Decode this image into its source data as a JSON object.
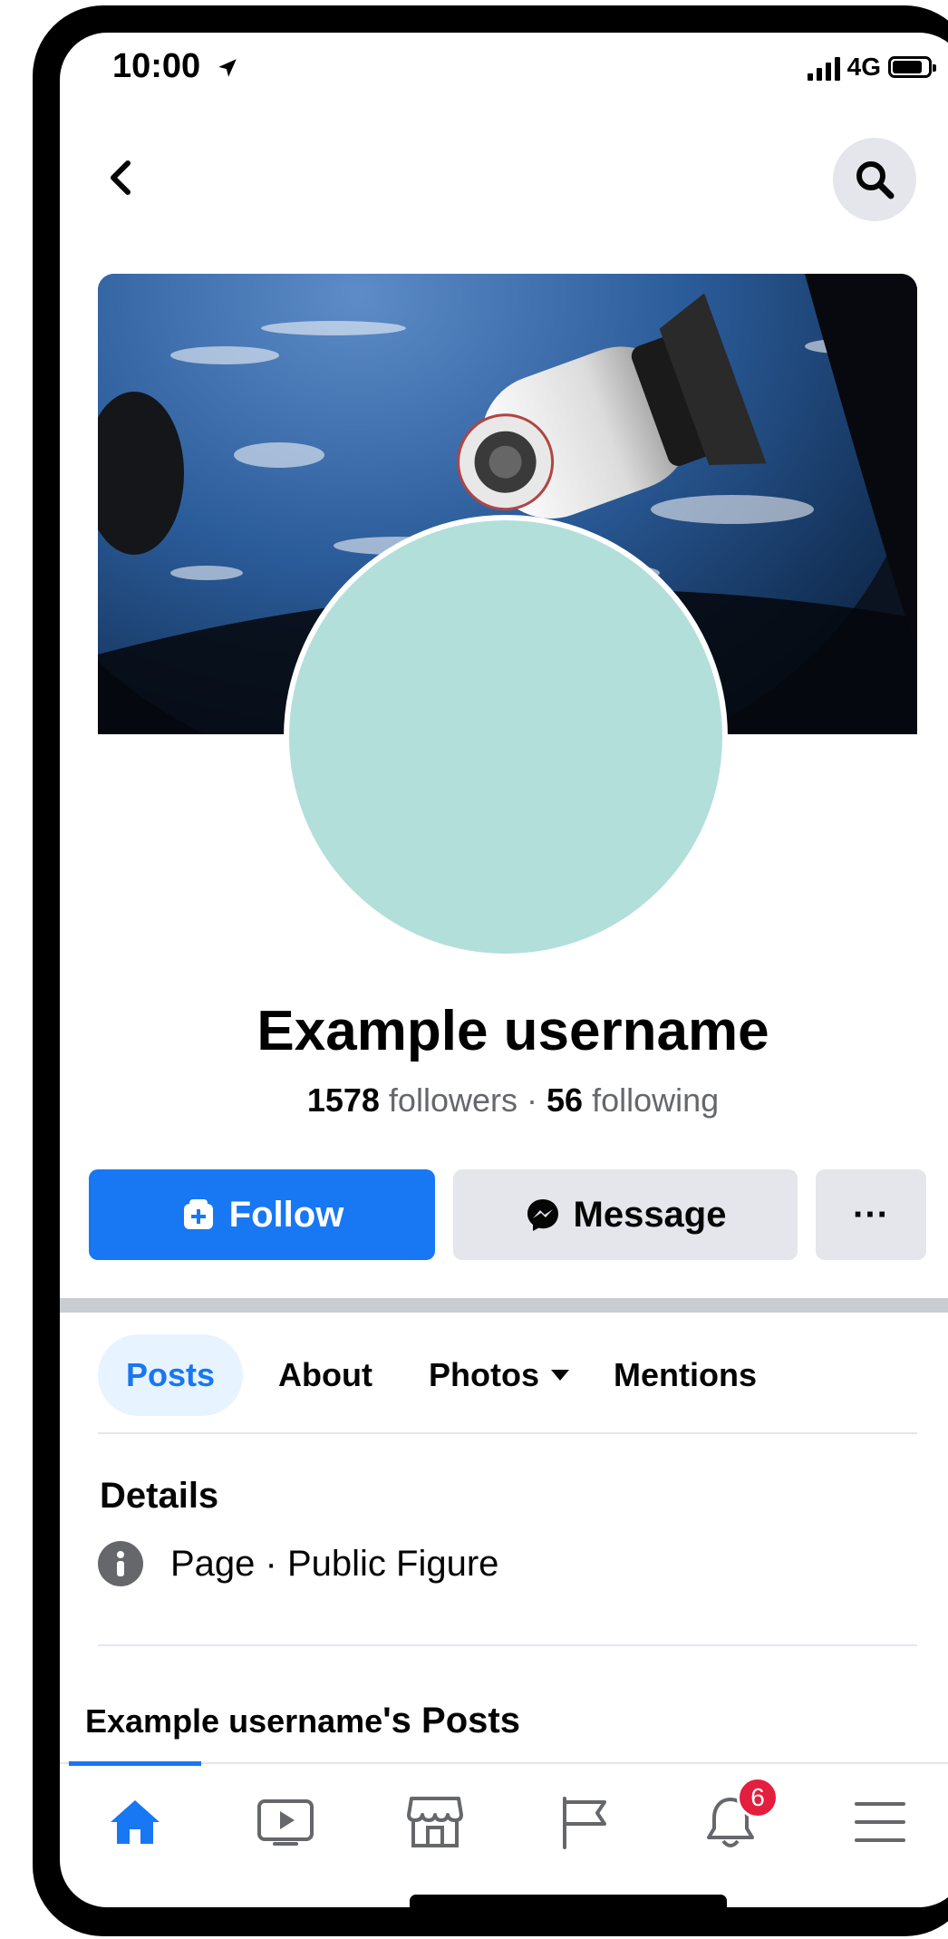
{
  "status_bar": {
    "time": "10:00",
    "network": "4G"
  },
  "nav": {
    "back_icon": "chevron-left-icon",
    "search_icon": "search-icon"
  },
  "profile": {
    "name": "Example username",
    "followers_count": "1578",
    "followers_label": "followers",
    "separator": "·",
    "following_count": "56",
    "following_label": "following"
  },
  "actions": {
    "follow_label": "Follow",
    "message_label": "Message",
    "more_label": "···"
  },
  "tabs": [
    {
      "label": "Posts",
      "active": true
    },
    {
      "label": "About",
      "active": false
    },
    {
      "label": "Photos",
      "active": false
    },
    {
      "label": "Mentions",
      "active": false
    }
  ],
  "details": {
    "title": "Details",
    "row_text": "Page · Public Figure"
  },
  "posts_section": {
    "name": "Example username",
    "suffix": "'s Posts"
  },
  "bottom_nav": {
    "items": [
      "home-icon",
      "video-icon",
      "marketplace-icon",
      "flag-icon",
      "bell-icon",
      "menu-icon"
    ],
    "notification_count": "6"
  },
  "colors": {
    "accent": "#1877f2",
    "badge": "#e41e3f",
    "avatar": "#b3dfdb"
  }
}
